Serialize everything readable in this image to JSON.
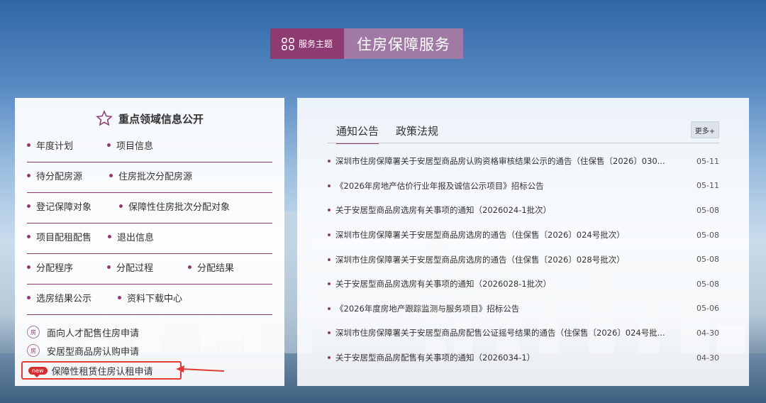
{
  "header": {
    "topic_label": "服务主题",
    "title": "住房保障服务"
  },
  "left": {
    "title": "重点领域信息公开",
    "rows": [
      [
        "年度计划",
        "项目信息"
      ],
      [
        "待分配房源",
        "住房批次分配房源"
      ],
      [
        "登记保障对象",
        "保障性住房批次分配对象"
      ],
      [
        "项目配租配售",
        "退出信息"
      ],
      [
        "分配程序",
        "分配过程",
        "分配结果"
      ],
      [
        "选房结果公示",
        "资料下载中心"
      ]
    ],
    "applications": [
      "面向人才配售住房申请",
      "安居型商品房认购申请"
    ],
    "highlight_app": "保障性租赁住房认租申请",
    "new_badge": "new"
  },
  "right": {
    "tabs": [
      "通知公告",
      "政策法规"
    ],
    "more_label": "更多+",
    "news": [
      {
        "title": "深圳市住房保障署关于安居型商品房认购资格审核结果公示的通告（住保售〔2026〕030...",
        "date": "05-11"
      },
      {
        "title": "《2026年房地产估价行业年报及诚信公示项目》招标公告",
        "date": "05-11"
      },
      {
        "title": "关于安居型商品房选房有关事项的通知（2026024-1批次）",
        "date": "05-08"
      },
      {
        "title": "深圳市住房保障署关于安居型商品房选房的通告（住保售〔2026〕024号批次）",
        "date": "05-08"
      },
      {
        "title": "深圳市住房保障署关于安居型商品房选房的通告（住保售〔2026〕028号批次）",
        "date": "05-08"
      },
      {
        "title": "关于安居型商品房选房有关事项的通知（2026028-1批次）",
        "date": "05-08"
      },
      {
        "title": "《2026年度房地产跟踪监测与服务项目》招标公告",
        "date": "05-06"
      },
      {
        "title": "深圳市住房保障署关于安居型商品房配售公证摇号结果的通告（住保售〔2026〕024号批...",
        "date": "04-30"
      },
      {
        "title": "关于安居型商品房配售有关事项的通知（2026034-1）",
        "date": "04-30"
      }
    ]
  },
  "colors": {
    "brand": "#8e3b72",
    "brand_light": "#a07aa4",
    "alert": "#e53935"
  },
  "icons": [
    "grid-icon",
    "star-outline-icon",
    "apply-icon",
    "new-badge-icon",
    "arrow-icon"
  ]
}
